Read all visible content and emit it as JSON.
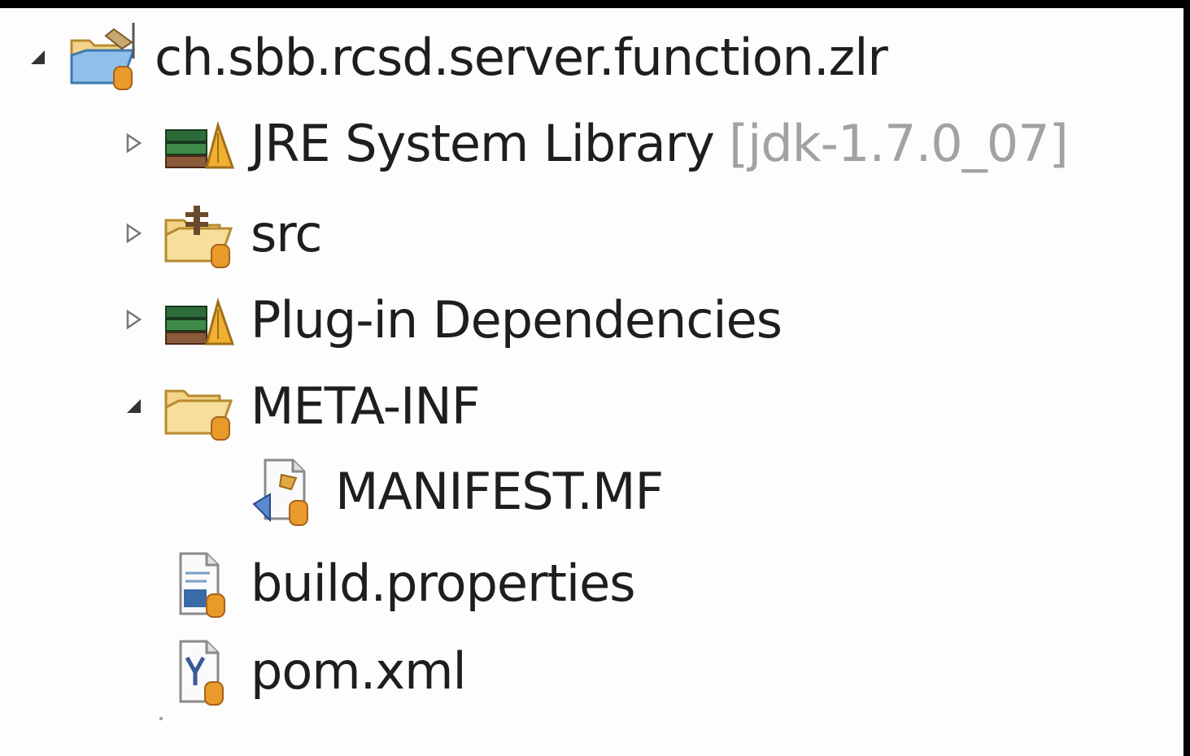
{
  "tree": {
    "items": [
      {
        "label": "ch.sbb.rcsd.server.function.zlr",
        "decoration": "",
        "icon": "plugin-project-icon",
        "state": "expanded"
      },
      {
        "label": "JRE System Library",
        "decoration": "[jdk-1.7.0_07]",
        "icon": "library-icon",
        "state": "collapsed"
      },
      {
        "label": "src",
        "decoration": "",
        "icon": "source-folder-icon",
        "state": "collapsed"
      },
      {
        "label": "Plug-in Dependencies",
        "decoration": "",
        "icon": "library-icon",
        "state": "collapsed"
      },
      {
        "label": "META-INF",
        "decoration": "",
        "icon": "folder-icon",
        "state": "expanded"
      },
      {
        "label": "MANIFEST.MF",
        "decoration": "",
        "icon": "manifest-file-icon",
        "state": "leaf"
      },
      {
        "label": "build.properties",
        "decoration": "",
        "icon": "properties-file-icon",
        "state": "leaf"
      },
      {
        "label": "pom.xml",
        "decoration": "",
        "icon": "xml-file-icon",
        "state": "leaf"
      }
    ]
  },
  "colors": {
    "text": "#1e1e1e",
    "decoration": "#a2a2a2",
    "background": "#fdfdfd",
    "folder": "#f0c870",
    "project_blue": "#6aa5d8",
    "library_green": "#2e6b3a",
    "library_orange": "#e8a030"
  }
}
